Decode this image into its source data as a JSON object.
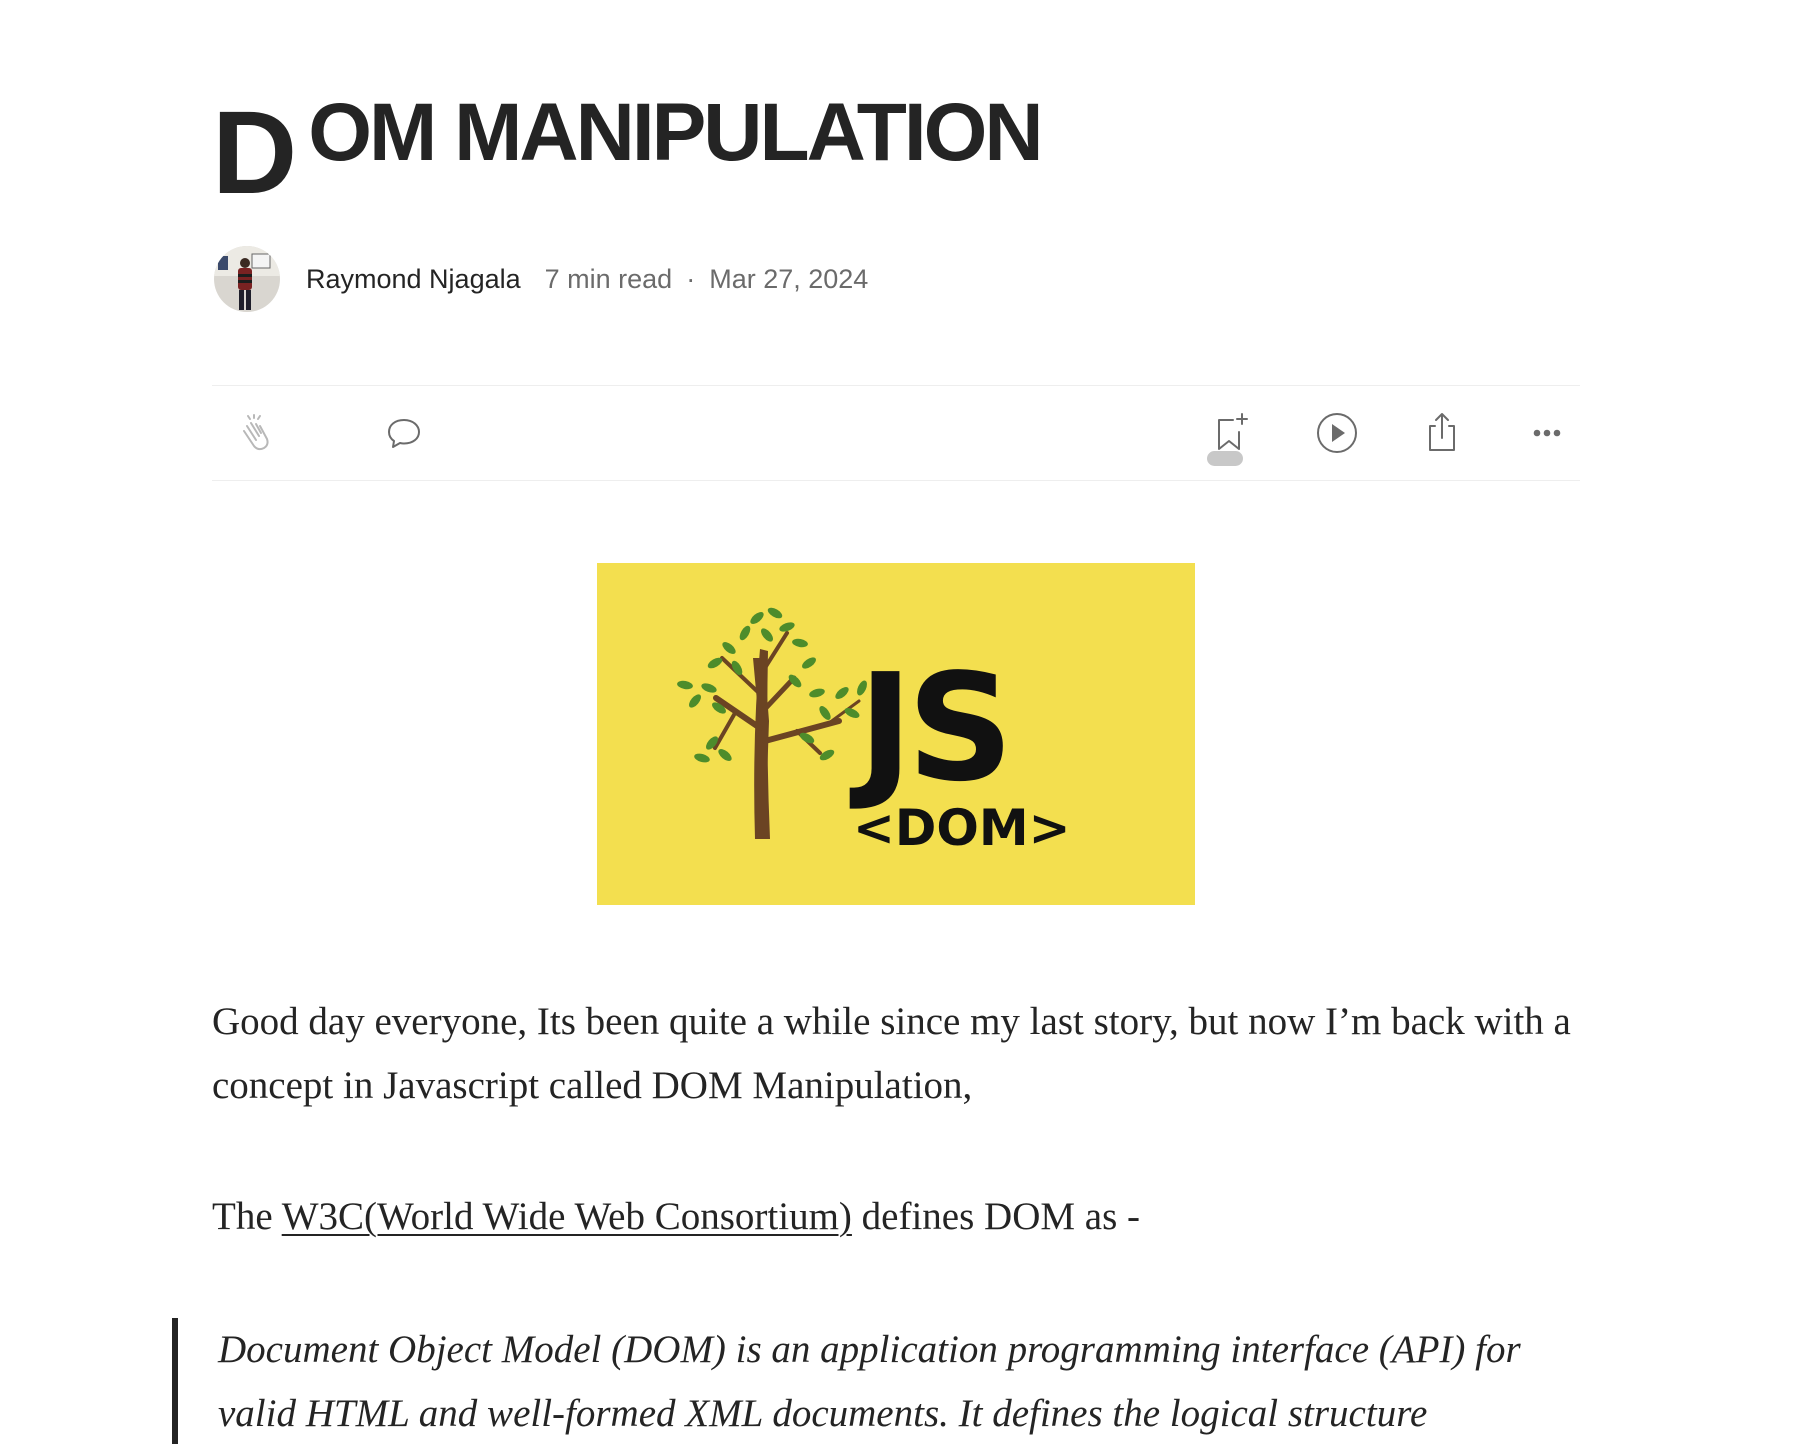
{
  "article": {
    "title_dropcap": "D",
    "title_rest": "OM MANIPULATION",
    "author": "Raymond Njagala",
    "read_time": "7 min read",
    "separator": "·",
    "date": "Mar 27, 2024"
  },
  "actions": {
    "clap_icon": "clap-icon",
    "comment_icon": "comment-icon",
    "save_icon": "bookmark-add-icon",
    "listen_icon": "play-icon",
    "share_icon": "share-icon",
    "more_icon": "more-icon"
  },
  "hero_image": {
    "background": "#f3df4f",
    "logo_text": "JS",
    "tag_text": "<DOM>"
  },
  "body": {
    "p1": "Good day everyone, Its been quite a while since my last story, but now I’m back with a concept in Javascript called DOM Manipulation,",
    "p2_before": "The ",
    "p2_link": "W3C(World Wide Web Consortium)",
    "p2_after": " defines DOM as -",
    "quote": "Document Object Model (DOM) is an application programming interface (API) for valid HTML and well-formed XML documents. It defines the logical structure"
  },
  "colors": {
    "text": "#242424",
    "muted": "#6b6b6b",
    "divider": "#eeeeee",
    "hero_yellow": "#f3df4f",
    "tree_trunk": "#6b4423",
    "leaf": "#4d8c2b"
  }
}
